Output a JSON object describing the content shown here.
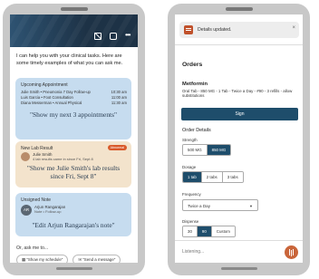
{
  "left_screen": {
    "header_icons": [
      "bot-off-icon",
      "chat-icon",
      "more-icon"
    ],
    "intro_text": "I can help you with your clinical tasks. Here are some timely examples of what you can ask me.",
    "appointment_card": {
      "title": "Upcoming Appointment",
      "rows": [
        {
          "text": "Julie Smith • Pneumonia 7 Day Follow-up",
          "time": "10:30 am"
        },
        {
          "text": "Luis Garcia • Foot Consultation",
          "time": "11:00 am"
        },
        {
          "text": "Diana Messerman • Annual Physical",
          "time": "11:30 am"
        }
      ],
      "quote": "\"Show my next 3 appointments\""
    },
    "lab_card": {
      "title": "New Lab Result",
      "badge": "Abnormal",
      "patient_name": "Julie Smith",
      "subtitle": "4 lab results came in since Fri, Sept 8",
      "quote_line1": "\"Show me Julie Smith's lab results",
      "quote_line2": "since Fri, Sept 8\""
    },
    "note_card": {
      "title": "Unsigned Note",
      "avatar_initials": "AR",
      "patient_name": "Arjun Rangarajan",
      "subtitle": "Note • Follow-up",
      "quote": "\"Edit Arjun Rangarajan's note\""
    },
    "or_ask_label": "Or, ask me to...",
    "chips": [
      {
        "label": "\"Show my schedule\"",
        "icon": "calendar-icon"
      },
      {
        "label": "\"Send a message\"",
        "icon": "message-icon"
      }
    ]
  },
  "right_screen": {
    "notification": {
      "text": "Details updated.",
      "icon": "document-icon",
      "close": "×"
    },
    "heading": "Orders",
    "medication": {
      "name": "Metformin",
      "detail": "Oral Tab - 850 MG - 1 Tab - Twice a Day - #90 - 3 refills - allow substitutions"
    },
    "sign_label": "Sign",
    "order_details_title": "Order Details",
    "strength": {
      "label": "Strength",
      "options": [
        "500 MG",
        "850 MG"
      ],
      "selected": 1
    },
    "dosage": {
      "label": "Dosage",
      "options": [
        "1 tab",
        "2 tabs",
        "3 tabs"
      ],
      "selected": 0
    },
    "frequency": {
      "label": "Frequency",
      "value": "Twice a Day"
    },
    "dispense": {
      "label": "Dispense",
      "options": [
        "30",
        "90",
        "Custom"
      ],
      "selected": 1
    },
    "listening_text": "Listening..."
  },
  "colors": {
    "header_navy": "#1d3246",
    "card_blue": "#c6dcef",
    "card_tan": "#f3e3cc",
    "primary_button": "#1e4d6b",
    "accent_orange": "#c9653a",
    "badge_red": "#d95a2b"
  }
}
